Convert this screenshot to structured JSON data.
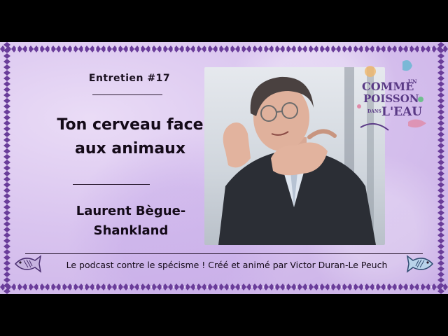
{
  "episode_label": "Entretien #17",
  "title_lines": [
    "Ton cerveau face",
    "aux animaux"
  ],
  "guest_lines": [
    "Laurent Bègue-",
    "Shankland"
  ],
  "tagline": "Le podcast contre le spécisme ! Créé et animé par Victor Duran-Le Peuch",
  "logo": {
    "line1": "COMME",
    "small1": "UN",
    "line2": "POISSON",
    "small2": "DANS",
    "line3": "L'EAU"
  },
  "colors": {
    "border": "#6a3d9a",
    "background": "#d9c4ef",
    "text": "#140a18",
    "logo_text": "#5a3a86"
  },
  "icons": [
    "portrait-photo",
    "fish-icon-left",
    "fish-icon-right",
    "logo-illustration"
  ]
}
